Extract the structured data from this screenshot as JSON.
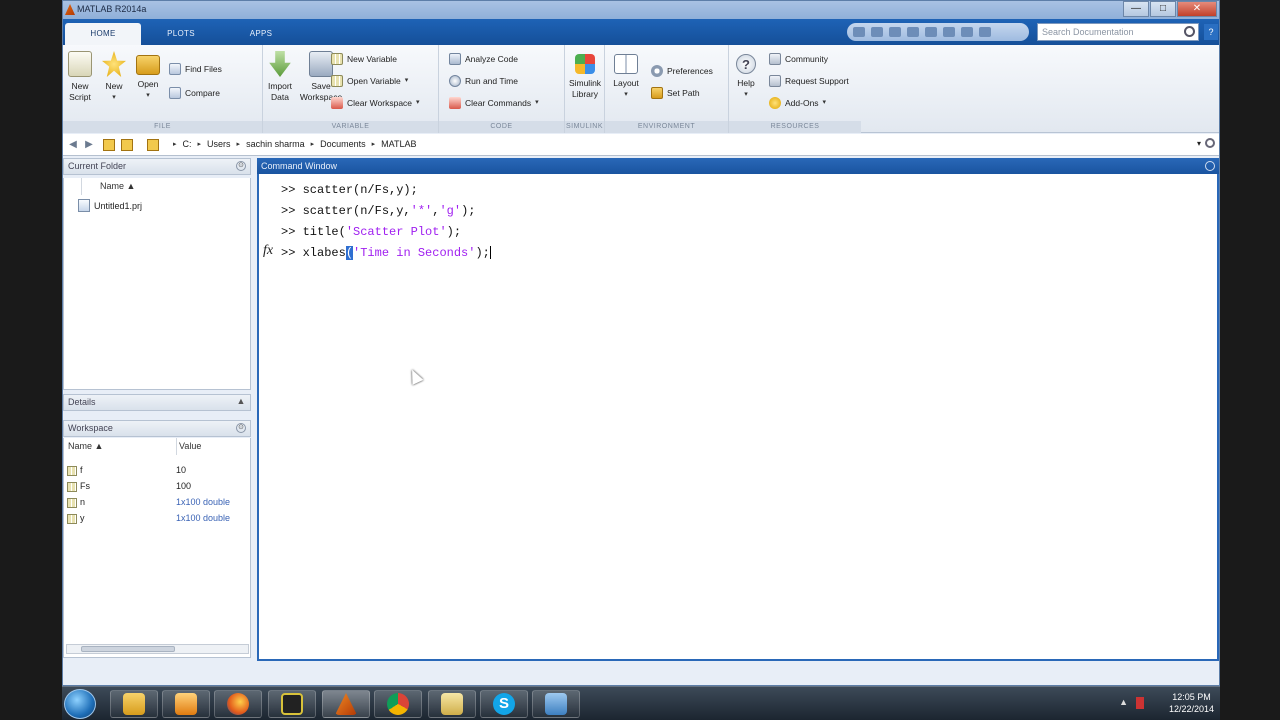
{
  "window": {
    "title": "MATLAB R2014a",
    "buttons": {
      "minimize": "—",
      "maximize": "□",
      "close": "✕"
    }
  },
  "ribbon_tabs": [
    "HOME",
    "PLOTS",
    "APPS"
  ],
  "search": {
    "placeholder": "Search Documentation"
  },
  "help_glyph": "?",
  "ribbon": {
    "file": {
      "label": "FILE",
      "new_script": [
        "New",
        "Script"
      ],
      "new": [
        "New",
        "▾"
      ],
      "open": [
        "Open",
        "▾"
      ],
      "find_files": "Find Files",
      "compare": "Compare"
    },
    "variable": {
      "label": "VARIABLE",
      "import_data": [
        "Import",
        "Data"
      ],
      "save_workspace": [
        "Save",
        "Workspace"
      ],
      "new_variable": "New Variable",
      "open_variable": "Open Variable",
      "clear_workspace": "Clear Workspace"
    },
    "code": {
      "label": "CODE",
      "analyze_code": "Analyze Code",
      "run_and_time": "Run and Time",
      "clear_commands": "Clear Commands"
    },
    "simulink": {
      "label": "SIMULINK",
      "library": [
        "Simulink",
        "Library"
      ]
    },
    "environment": {
      "label": "ENVIRONMENT",
      "layout": [
        "Layout",
        "▾"
      ],
      "preferences": "Preferences",
      "set_path": "Set Path"
    },
    "resources": {
      "label": "RESOURCES",
      "help": [
        "Help",
        "▾"
      ],
      "community": "Community",
      "request_support": "Request Support",
      "add_ons": "Add-Ons"
    }
  },
  "address": {
    "crumbs": [
      "C:",
      "Users",
      "sachin sharma",
      "Documents",
      "MATLAB"
    ]
  },
  "current_folder": {
    "title": "Current Folder",
    "col_name": "Name ▲",
    "files": [
      "Untitled1.prj"
    ]
  },
  "details": {
    "title": "Details"
  },
  "workspace": {
    "title": "Workspace",
    "col_name": "Name ▲",
    "col_value": "Value",
    "vars": [
      {
        "name": "f",
        "value": "10"
      },
      {
        "name": "Fs",
        "value": "100"
      },
      {
        "name": "n",
        "value": "1x100 double"
      },
      {
        "name": "y",
        "value": "1x100 double"
      }
    ]
  },
  "command_window": {
    "title": "Command Window",
    "prompt": ">>",
    "fx": "fx",
    "lines": [
      {
        "code": "scatter(n/Fs,y);"
      },
      {
        "pre": "scatter(n/Fs,y,",
        "str1": "'*'",
        "mid": ",",
        "str2": "'g'",
        "post": ");"
      },
      {
        "pre": "title(",
        "str": "'Scatter Plot'",
        "post": ");"
      },
      {
        "pre": "xlabes",
        "cursor": "(",
        "str": "'Time in Seconds'",
        "post": ");"
      }
    ]
  },
  "taskbar": {
    "clock_time": "12:05 PM",
    "clock_date": "12/22/2014",
    "tray_up": "▲"
  }
}
